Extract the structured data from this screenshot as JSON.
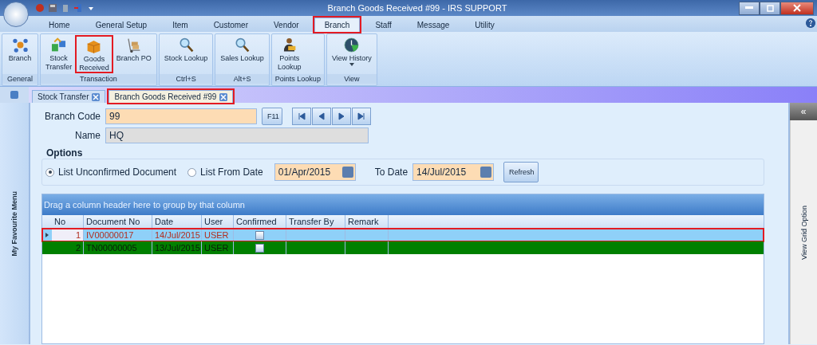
{
  "window": {
    "title": "Branch Goods Received #99 - IRS SUPPORT"
  },
  "ribbon_tabs": [
    {
      "label": "Home",
      "selected": false
    },
    {
      "label": "General Setup",
      "selected": false
    },
    {
      "label": "Item",
      "selected": false
    },
    {
      "label": "Customer",
      "selected": false
    },
    {
      "label": "Vendor",
      "selected": false
    },
    {
      "label": "Branch",
      "selected": true
    },
    {
      "label": "Staff",
      "selected": false
    },
    {
      "label": "Message",
      "selected": false
    },
    {
      "label": "Utility",
      "selected": false
    }
  ],
  "ribbon_groups": [
    {
      "label": "General",
      "buttons": [
        {
          "lines": [
            "Branch"
          ],
          "kind": "network",
          "highlighted": false
        }
      ]
    },
    {
      "label": "Transaction",
      "buttons": [
        {
          "lines": [
            "Stock",
            "Transfer"
          ],
          "kind": "transfer",
          "highlighted": false
        },
        {
          "lines": [
            "Goods",
            "Received"
          ],
          "kind": "box",
          "highlighted": true
        },
        {
          "lines": [
            "Branch PO"
          ],
          "kind": "trolley",
          "highlighted": false
        }
      ]
    },
    {
      "label": "Ctrl+S",
      "buttons": [
        {
          "lines": [
            "Stock Lookup"
          ],
          "kind": "magnifier",
          "highlighted": false
        }
      ]
    },
    {
      "label": "Alt+S",
      "buttons": [
        {
          "lines": [
            "Sales Lookup"
          ],
          "kind": "magnifier",
          "highlighted": false
        }
      ]
    },
    {
      "label": "Points Lookup",
      "buttons": [
        {
          "lines": [
            "Points",
            "Lookup"
          ],
          "kind": "person",
          "highlighted": false
        }
      ]
    },
    {
      "label": "View",
      "buttons": [
        {
          "lines": [
            "View History"
          ],
          "kind": "clock",
          "highlighted": false,
          "dropdown": true
        }
      ]
    }
  ],
  "doc_tabs": [
    {
      "label": "Stock Transfer",
      "selected": false
    },
    {
      "label": "Branch Goods Received #99",
      "selected": true
    }
  ],
  "sidebar": {
    "label": "My Favourite Menu"
  },
  "form": {
    "branch_code": {
      "label": "Branch Code",
      "value": "99",
      "lookup_button": "F11"
    },
    "name": {
      "label": "Name",
      "value": "HQ"
    }
  },
  "options": {
    "title": "Options",
    "radios": [
      {
        "label": "List Unconfirmed Document",
        "selected": true
      },
      {
        "label": "List From Date",
        "selected": false
      }
    ],
    "from_date": "01/Apr/2015",
    "to_date_label": "To Date",
    "to_date": "14/Jul/2015",
    "refresh_button": "Refresh"
  },
  "grid": {
    "group_hint": "Drag a column header here to group by that column",
    "columns": [
      "No",
      "Document No",
      "Date",
      "User",
      "Confirmed",
      "Transfer By",
      "Remark"
    ],
    "rows": [
      {
        "no": "1",
        "document_no": "IV00000017",
        "date": "14/Jul/2015",
        "user": "USER",
        "confirmed": false,
        "selected": true,
        "color": "#8fd0f8"
      },
      {
        "no": "2",
        "document_no": "TN00000005",
        "date": "13/Jul/2015",
        "user": "USER",
        "confirmed": false,
        "selected": false,
        "color": "#008000"
      }
    ]
  },
  "right_panel": {
    "label": "View Grid Option",
    "collapse_glyph": "«"
  }
}
